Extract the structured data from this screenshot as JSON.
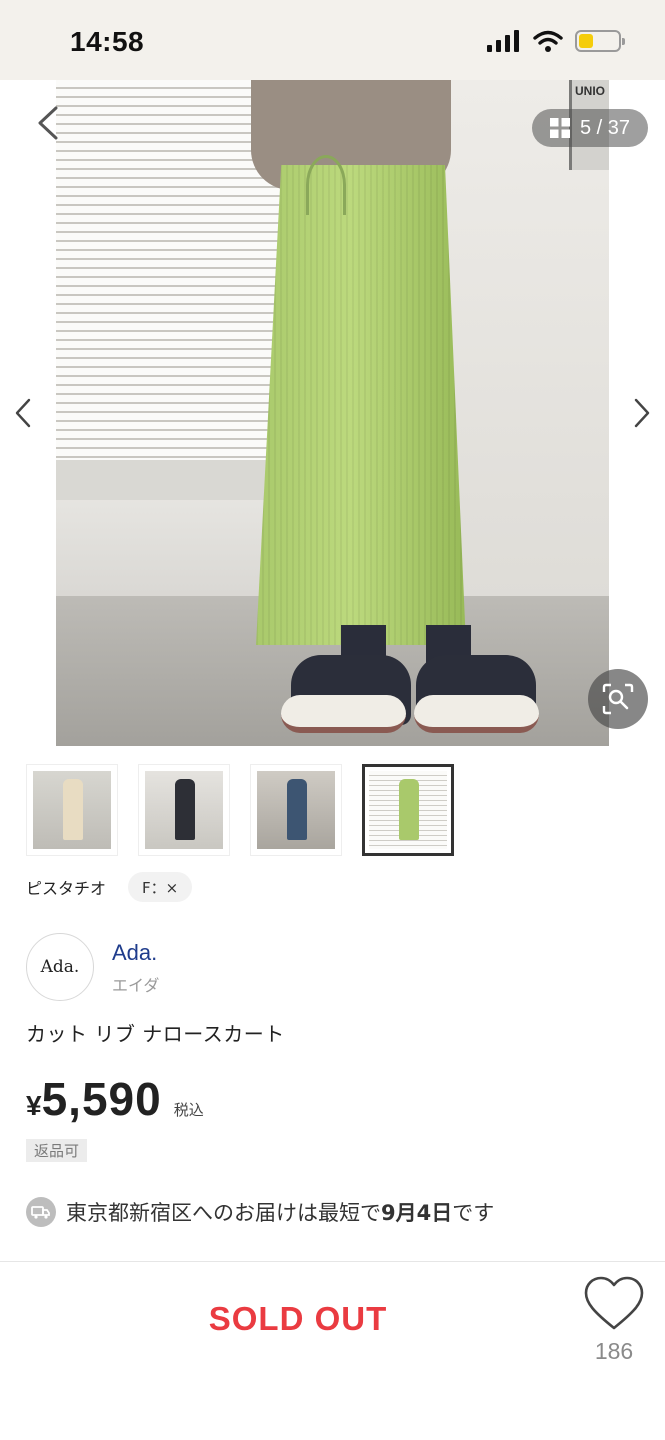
{
  "status_bar": {
    "time": "14:58",
    "signal_icon": "cellular-signal-icon",
    "wifi_icon": "wifi-icon",
    "battery_icon": "battery-icon",
    "battery_level": 0.38,
    "battery_color": "#f5cd0a"
  },
  "gallery": {
    "back_icon": "chevron-left-icon",
    "grid_icon": "grid-icon",
    "counter": "5 / 37",
    "current": 5,
    "total": 37,
    "prev_icon": "chevron-left-icon",
    "next_icon": "chevron-right-icon",
    "zoom_icon": "zoom-search-icon",
    "photo_sign": "UNIO"
  },
  "thumbnails": [
    {
      "name": "thumbnail-1",
      "active": false,
      "color": "#e8dcc2"
    },
    {
      "name": "thumbnail-2",
      "active": false,
      "color": "#2d2f36"
    },
    {
      "name": "thumbnail-3",
      "active": false,
      "color": "#3d5572"
    },
    {
      "name": "thumbnail-4",
      "active": true,
      "color": "#a9c96b"
    }
  ],
  "variant": {
    "color": "ピスタチオ",
    "size": "F：×"
  },
  "brand": {
    "logo_text": "Ada.",
    "name": "Ada.",
    "kana": "エイダ"
  },
  "product": {
    "name": "カット リブ ナロースカート",
    "currency": "¥",
    "price": "5,590",
    "tax_label": "税込",
    "return_badge": "返品可"
  },
  "delivery": {
    "icon": "delivery-truck-icon",
    "text_prefix": "東京都新宿区へのお届けは最短で",
    "date": "9月4日",
    "text_suffix": "です"
  },
  "footer": {
    "sold_out": "SOLD OUT",
    "favorite_icon": "heart-outline-icon",
    "favorite_count": "186"
  },
  "colors": {
    "brand_link": "#1f3c8c",
    "sold_out": "#ea3b41",
    "status_bg": "#f3f1ec"
  }
}
